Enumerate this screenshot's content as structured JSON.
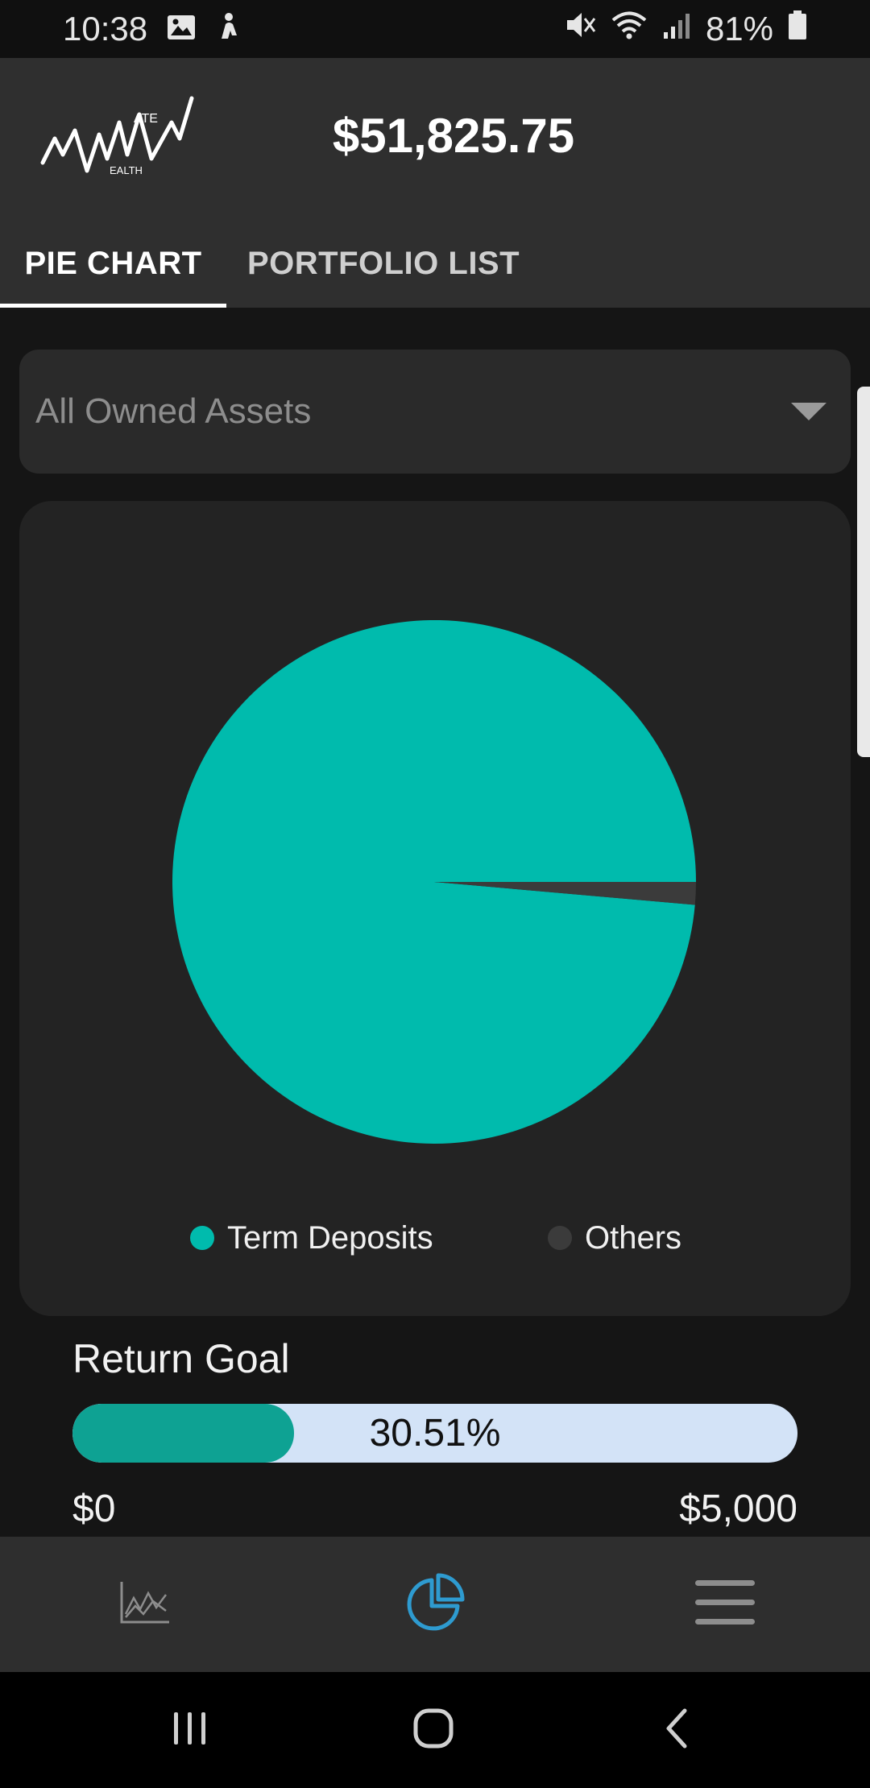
{
  "status_bar": {
    "time": "10:38",
    "battery": "81%",
    "icons": [
      "gallery-icon",
      "notification-icon",
      "mute-icon",
      "wifi-icon",
      "signal-icon",
      "battery-icon"
    ]
  },
  "header": {
    "logo_text_top": "ATE",
    "logo_text_bottom": "EALTH",
    "total_value": "$51,825.75"
  },
  "tabs": [
    {
      "label": "PIE CHART",
      "selected": true
    },
    {
      "label": "PORTFOLIO LIST",
      "selected": false
    }
  ],
  "asset_filter": {
    "selected": "All Owned Assets"
  },
  "chart_data": {
    "type": "pie",
    "labels": [
      "Term Deposits",
      "Others"
    ],
    "values": [
      98.6,
      1.4
    ],
    "colors": [
      "#00bbad",
      "#3b3b3b"
    ],
    "legend_position": "bottom"
  },
  "return_goal": {
    "title": "Return Goal",
    "percent_label": "30.51%",
    "progress_fraction": 0.3051,
    "min_label": "$0",
    "max_label": "$5,000",
    "fill_color": "#0ea293"
  },
  "bottom_nav": [
    {
      "icon": "trends-icon",
      "active": false
    },
    {
      "icon": "pie-chart-icon",
      "active": true
    },
    {
      "icon": "menu-icon",
      "active": false
    }
  ],
  "colors": {
    "accent": "#00bbad",
    "active_nav": "#2e9bd0"
  }
}
